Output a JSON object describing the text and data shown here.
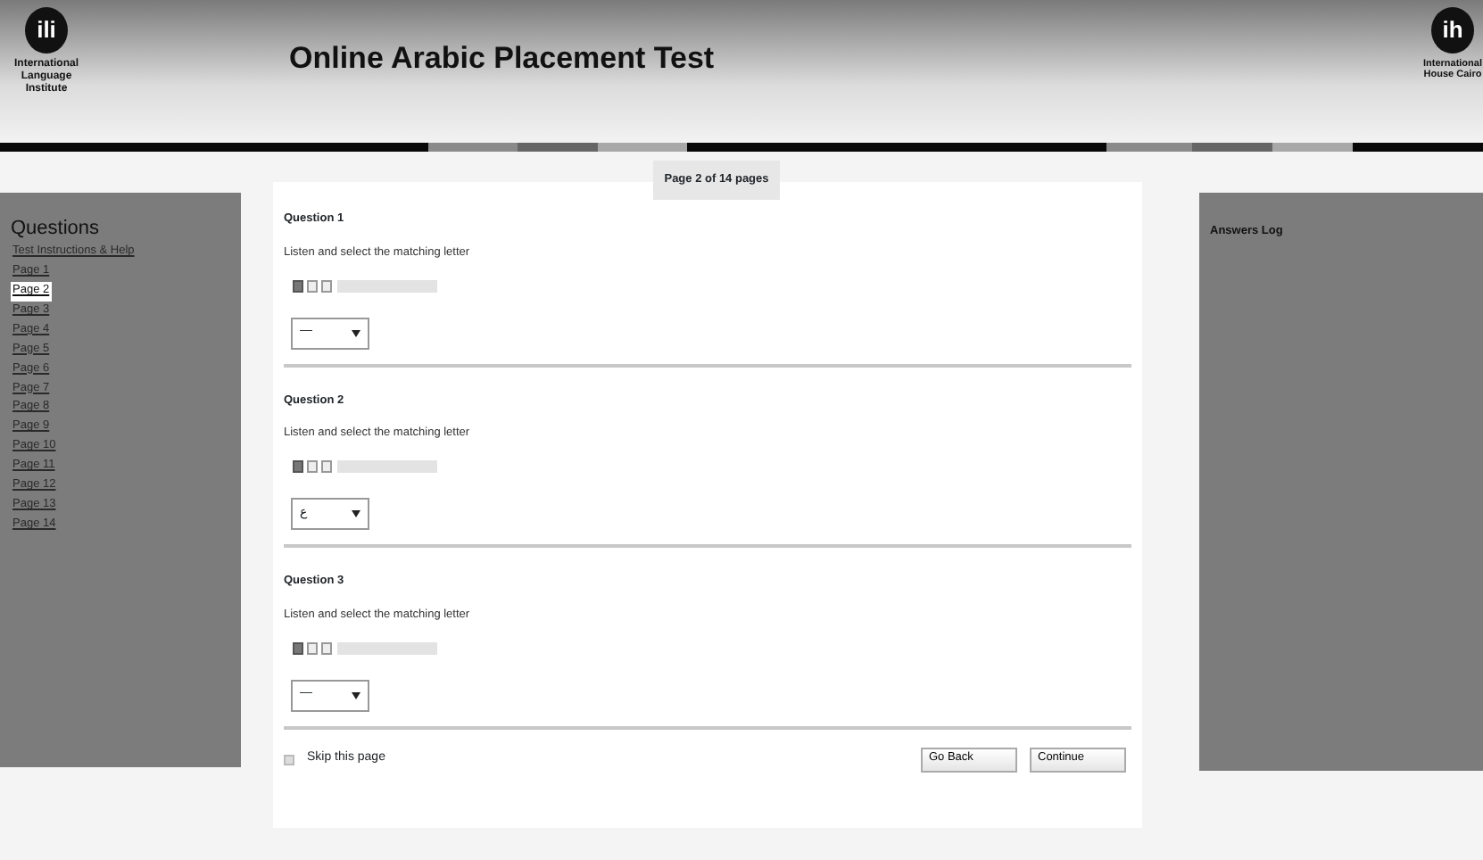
{
  "header": {
    "left_logo": {
      "mark": "ili",
      "caption": [
        "International",
        "Language",
        "Institute"
      ]
    },
    "title": "Online Arabic Placement Test",
    "right_logo": {
      "mark": "ih",
      "caption": [
        "International",
        "House",
        "Cairo"
      ]
    }
  },
  "sidebar": {
    "title": "Questions",
    "items": [
      {
        "label": "Test Instructions & Help",
        "selected": false
      },
      {
        "label": "Page 1",
        "selected": false
      },
      {
        "label": "Page 2",
        "selected": true
      },
      {
        "label": "Page 3",
        "selected": false
      },
      {
        "label": "Page 4",
        "selected": false
      },
      {
        "label": "Page 5",
        "selected": false
      },
      {
        "label": "Page 6",
        "selected": false
      },
      {
        "label": "Page 7",
        "selected": false
      },
      {
        "label": "Page 8",
        "selected": false
      },
      {
        "label": "Page 9",
        "selected": false
      },
      {
        "label": "Page 10",
        "selected": false
      },
      {
        "label": "Page 11",
        "selected": false
      },
      {
        "label": "Page 12",
        "selected": false
      },
      {
        "label": "Page 13",
        "selected": false
      },
      {
        "label": "Page 14",
        "selected": false
      }
    ]
  },
  "page_indicator": "Page 2 of 14 pages",
  "questions": [
    {
      "title": "Question 1",
      "prompt": "Listen and select the matching letter",
      "answer": "—",
      "level": 0
    },
    {
      "title": "Question 2",
      "prompt": "Listen and select the matching letter",
      "answer": "ع",
      "level": 0
    },
    {
      "title": "Question 3",
      "prompt": "Listen and select the matching letter",
      "answer": "—",
      "level": 0
    }
  ],
  "skip": {
    "label": "Skip this page",
    "checked": false
  },
  "buttons": [
    "Go Back",
    "Continue"
  ],
  "answers_log": {
    "title": "Answers Log"
  }
}
